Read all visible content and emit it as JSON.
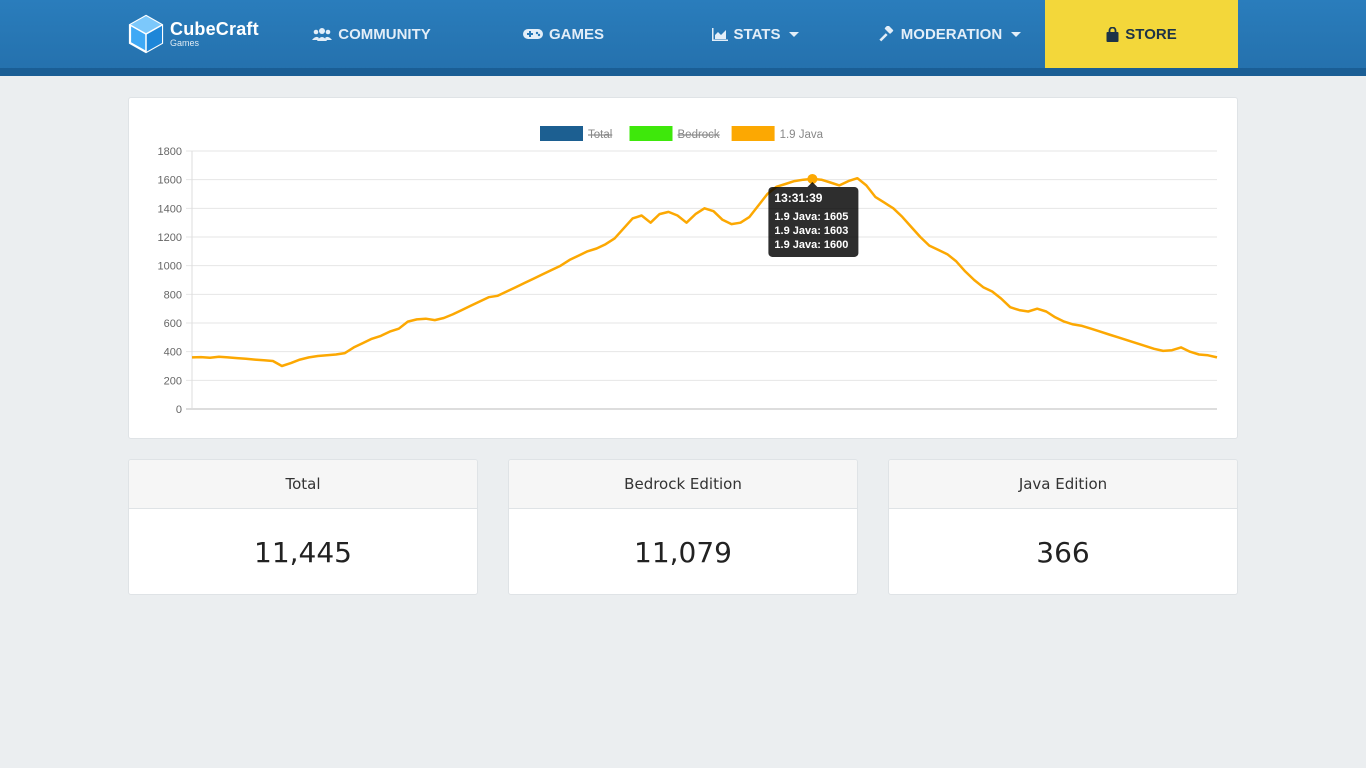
{
  "nav": {
    "logo_main": "CubeCraft",
    "logo_sub": "Games",
    "items": [
      {
        "label": "COMMUNITY",
        "icon": "users-icon"
      },
      {
        "label": "GAMES",
        "icon": "gamepad-icon"
      },
      {
        "label": "STATS",
        "icon": "area-chart-icon",
        "dropdown": true
      },
      {
        "label": "MODERATION",
        "icon": "gavel-icon",
        "dropdown": true
      },
      {
        "label": "STORE",
        "icon": "shopping-bag-icon"
      }
    ],
    "colors": {
      "bar": "#2677b6",
      "store": "#f3d73a"
    }
  },
  "chart_data": {
    "type": "line",
    "legend": [
      {
        "name": "Total",
        "color": "#1c5f91",
        "hidden": true
      },
      {
        "name": "Bedrock",
        "color": "#3ee80b",
        "hidden": true
      },
      {
        "name": "1.9 Java",
        "color": "#fca802",
        "hidden": false
      }
    ],
    "yticks": [
      "1800",
      "1600",
      "1400",
      "1200",
      "1000",
      "800",
      "600",
      "400",
      "200",
      "0"
    ],
    "ylim": [
      0,
      1800
    ],
    "series": [
      {
        "name": "1.9 Java",
        "color": "#fca802",
        "values": [
          360,
          362,
          358,
          365,
          360,
          355,
          350,
          345,
          340,
          335,
          300,
          320,
          345,
          360,
          370,
          375,
          380,
          390,
          430,
          460,
          490,
          510,
          540,
          560,
          610,
          625,
          630,
          620,
          635,
          660,
          690,
          720,
          750,
          780,
          790,
          820,
          850,
          880,
          910,
          940,
          970,
          1000,
          1040,
          1070,
          1100,
          1120,
          1150,
          1190,
          1260,
          1330,
          1350,
          1300,
          1360,
          1375,
          1350,
          1300,
          1360,
          1400,
          1380,
          1320,
          1290,
          1300,
          1340,
          1420,
          1500,
          1550,
          1570,
          1590,
          1600,
          1605,
          1600,
          1580,
          1560,
          1590,
          1610,
          1560,
          1480,
          1440,
          1400,
          1340,
          1270,
          1200,
          1140,
          1110,
          1080,
          1030,
          960,
          900,
          850,
          820,
          770,
          710,
          690,
          680,
          700,
          680,
          640,
          610,
          590,
          580,
          560,
          540,
          520,
          500,
          480,
          460,
          440,
          420,
          405,
          410,
          430,
          400,
          380,
          375,
          360
        ]
      }
    ],
    "tooltip": {
      "title": "13:31:39",
      "lines": [
        "1.9 Java: 1605",
        "1.9 Java: 1603",
        "1.9 Java: 1600"
      ],
      "at_index": 69
    }
  },
  "stats": [
    {
      "label": "Total",
      "value": "11,445"
    },
    {
      "label": "Bedrock Edition",
      "value": "11,079"
    },
    {
      "label": "Java Edition",
      "value": "366"
    }
  ]
}
